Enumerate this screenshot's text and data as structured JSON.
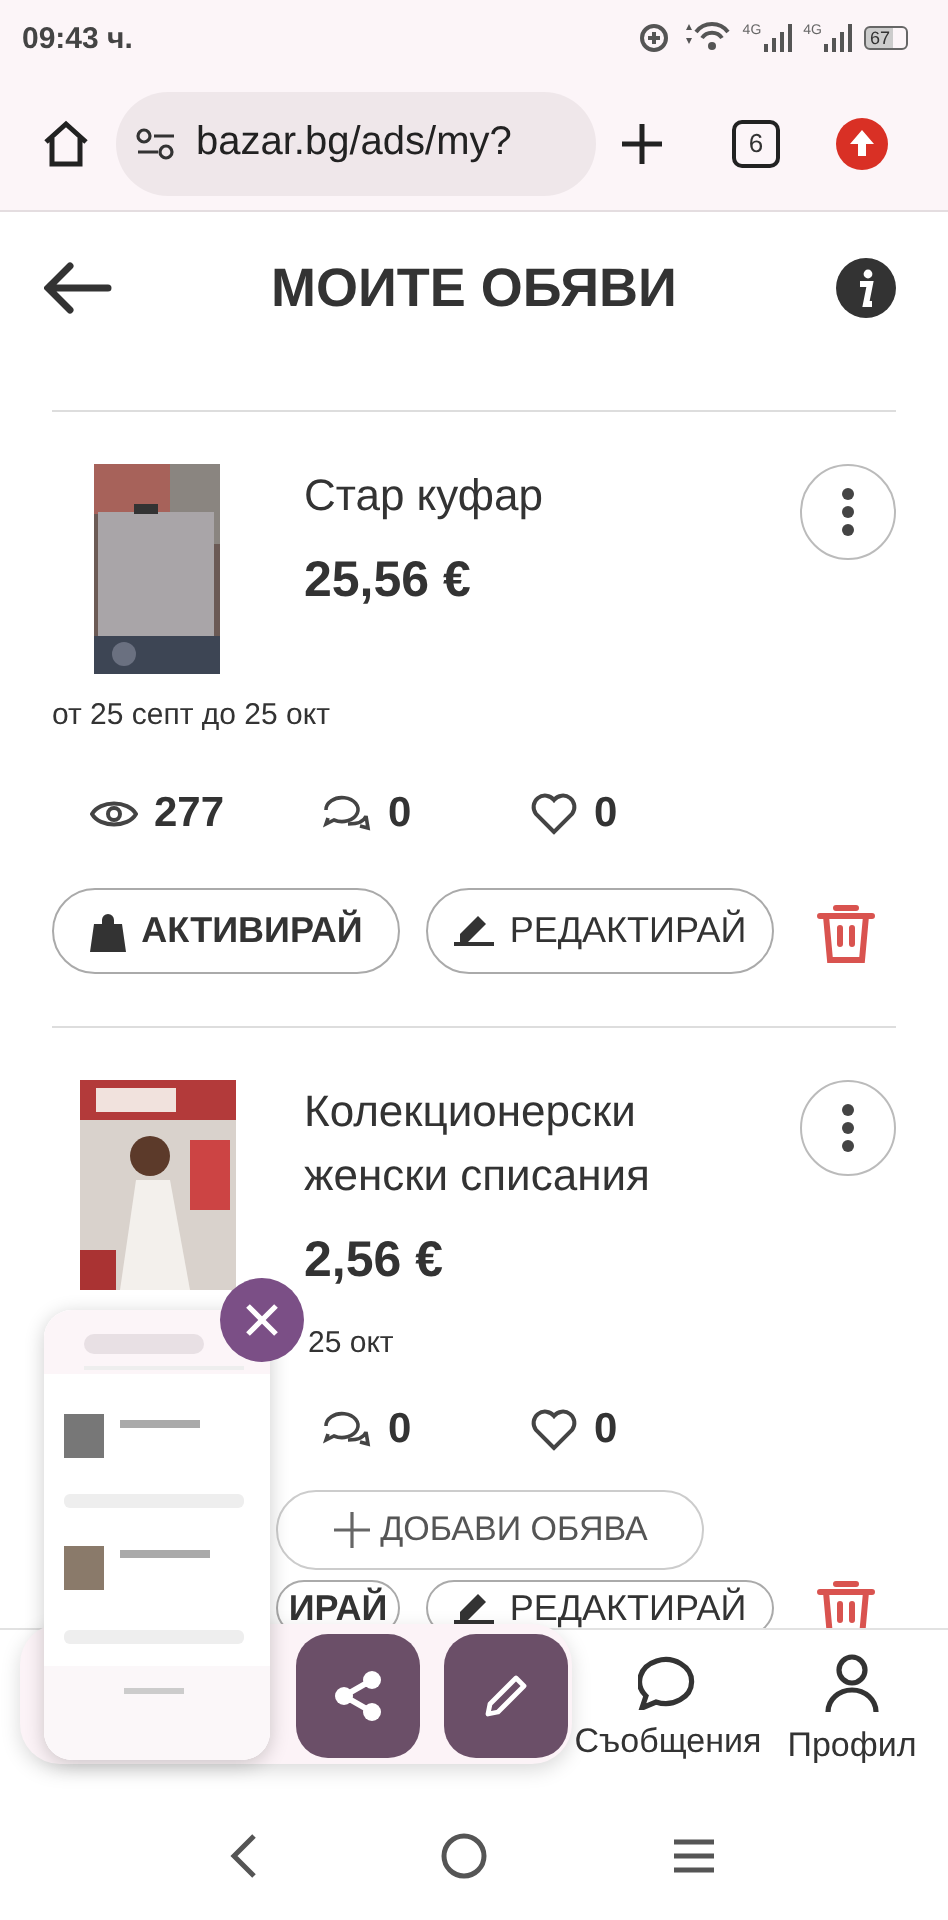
{
  "status_bar": {
    "time": "09:43 ч.",
    "network_labels": [
      "4G",
      "4G"
    ],
    "battery": "67"
  },
  "browser": {
    "url": "bazar.bg/ads/my?",
    "tab_count": "6"
  },
  "header": {
    "title": "МОИТЕ ОБЯВИ"
  },
  "ads": [
    {
      "title": "Стар куфар",
      "price": "25,56 €",
      "dates": "от 25 септ до 25 окт",
      "views": "277",
      "comments": "0",
      "likes": "0",
      "activate": "АКТИВИРАЙ",
      "edit": "РЕДАКТИРАЙ"
    },
    {
      "title": "Колекционерски женски списания",
      "price": "2,56 €",
      "dates": "25 окт",
      "comments": "0",
      "likes": "0",
      "activate": "ИРАЙ",
      "edit": "РЕДАКТИРАЙ"
    }
  ],
  "add_button": {
    "label": "ДОБАВИ ОБЯВА"
  },
  "bottom_nav": [
    {
      "label": "Съобщения"
    },
    {
      "label": "Профил"
    }
  ]
}
